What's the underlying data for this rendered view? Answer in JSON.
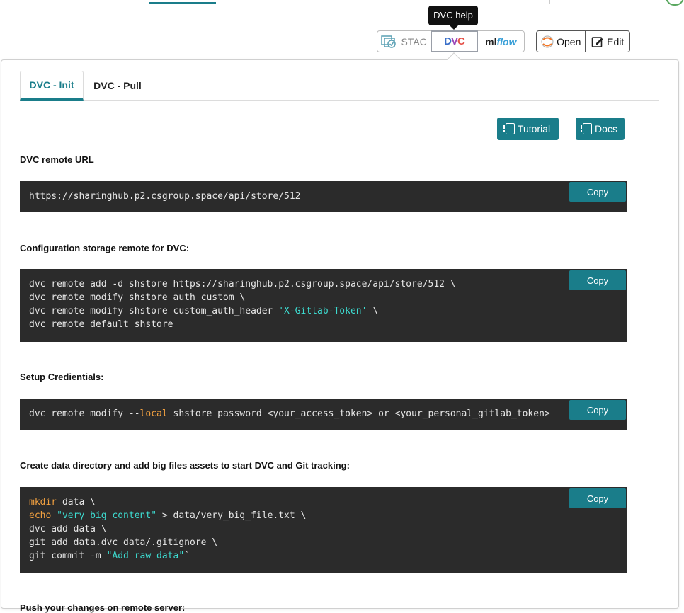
{
  "tooltip": "DVC help",
  "toolbar": {
    "stac_label": "STAC",
    "dvc_d": "D",
    "dvc_v": "V",
    "dvc_c": "C",
    "mlflow_ml": "ml",
    "mlflow_flow": "flow",
    "open_label": "Open",
    "edit_label": "Edit"
  },
  "tabs": [
    {
      "label": "DVC - Init",
      "active": true
    },
    {
      "label": "DVC - Pull",
      "active": false
    }
  ],
  "buttons": {
    "tutorial": "Tutorial",
    "docs": "Docs",
    "copy": "Copy"
  },
  "sections": {
    "remote_url_label": "DVC remote URL",
    "remote_url": "https://sharinghub.p2.csgroup.space/api/store/512",
    "config_label": "Configuration storage remote for DVC:",
    "config_lines": [
      "dvc remote add -d shstore https://sharinghub.p2.csgroup.space/api/store/512 \\",
      "dvc remote modify shstore auth custom \\",
      "dvc remote modify shstore custom_auth_header ",
      "'X-Gitlab-Token'",
      " \\",
      "dvc remote default shstore"
    ],
    "credentials_label": "Setup Credientials:",
    "credentials_pre": "dvc remote modify --",
    "credentials_kw": "local",
    "credentials_post": " shstore password <your_access_token> or <your_personal_gitlab_token>",
    "data_label": "Create data directory and add big files assets to start DVC and Git tracking:",
    "data_l1_kw": "mkdir",
    "data_l1_rest": " data \\",
    "data_l2_kw": "echo",
    "data_l2_space": " ",
    "data_l2_str": "\"very big content\"",
    "data_l2_rest": " > data/very_big_file.txt \\",
    "data_l3": "dvc add data \\",
    "data_l4": "git add data.dvc data/.gitignore \\",
    "data_l5_pre": "git commit -m ",
    "data_l5_str": "\"Add raw data\"",
    "data_l5_post": "`",
    "push_label": "Push your changes on remote server:"
  }
}
